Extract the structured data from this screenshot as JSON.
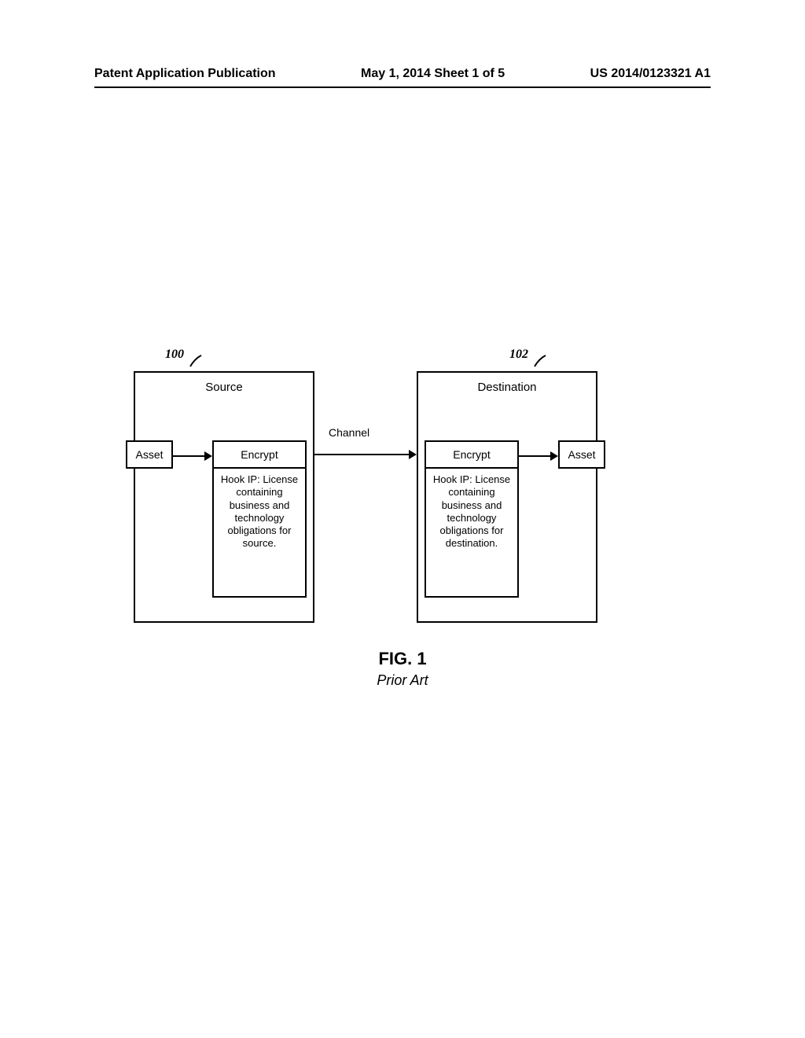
{
  "header": {
    "left": "Patent Application Publication",
    "center": "May 1, 2014   Sheet 1 of 5",
    "right": "US 2014/0123321 A1"
  },
  "refs": {
    "r100": "100",
    "r102": "102"
  },
  "source": {
    "title": "Source",
    "asset": "Asset",
    "encrypt": "Encrypt",
    "hook": "Hook IP: License containing business and technology obligations for source."
  },
  "destination": {
    "title": "Destination",
    "asset": "Asset",
    "encrypt": "Encrypt",
    "hook": "Hook IP: License containing business and technology obligations for destination."
  },
  "channel": "Channel",
  "figure": {
    "title": "FIG. 1",
    "subtitle": "Prior Art"
  }
}
